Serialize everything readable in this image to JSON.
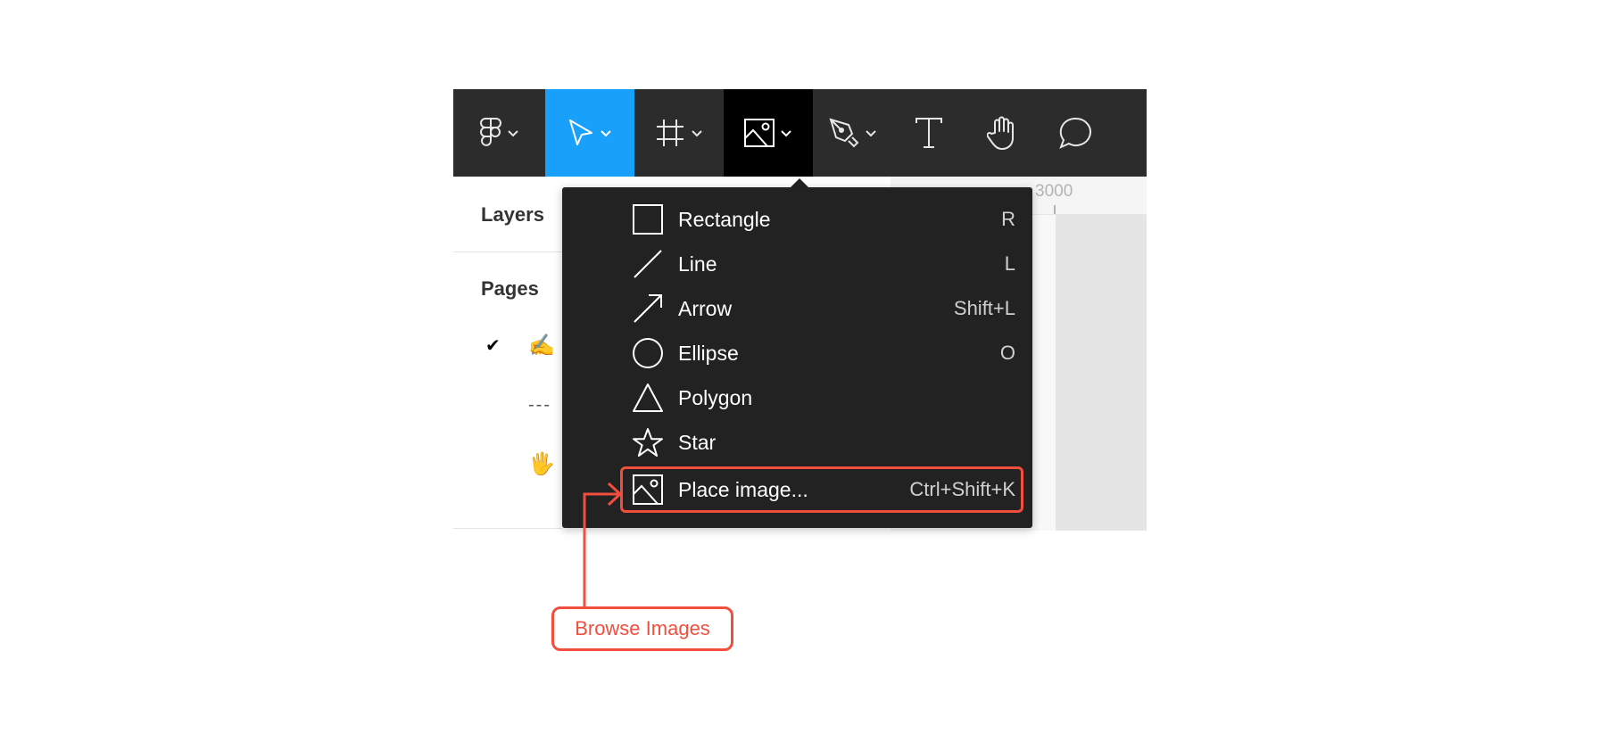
{
  "toolbar": {
    "tools": [
      {
        "name": "main-menu",
        "icon": "figma-logo-icon",
        "has_dropdown": true
      },
      {
        "name": "move-tool",
        "icon": "cursor-arrow-icon",
        "has_dropdown": true,
        "active": true
      },
      {
        "name": "frame-tool",
        "icon": "frame-hash-icon",
        "has_dropdown": true
      },
      {
        "name": "shape-tool",
        "icon": "image-icon",
        "has_dropdown": true,
        "open": true
      },
      {
        "name": "pen-tool",
        "icon": "pen-nib-icon",
        "has_dropdown": true
      },
      {
        "name": "text-tool",
        "icon": "text-t-icon",
        "has_dropdown": false
      },
      {
        "name": "hand-tool",
        "icon": "hand-icon",
        "has_dropdown": false
      },
      {
        "name": "comment-tool",
        "icon": "speech-bubble-icon",
        "has_dropdown": false
      }
    ],
    "colors": {
      "background": "#2c2c2c",
      "active": "#18a0fb",
      "open": "#000000"
    }
  },
  "left_panel": {
    "layers_title": "Layers",
    "pages_title": "Pages",
    "pages": [
      {
        "checked": true,
        "emoji": "✍️",
        "label": ""
      },
      {
        "checked": false,
        "emoji": "",
        "label": "---"
      },
      {
        "checked": false,
        "emoji": "🖐️",
        "label": ""
      }
    ]
  },
  "ruler": {
    "label": "3000"
  },
  "menu": {
    "items": [
      {
        "icon": "rectangle-icon",
        "label": "Rectangle",
        "shortcut": "R"
      },
      {
        "icon": "line-icon",
        "label": "Line",
        "shortcut": "L"
      },
      {
        "icon": "arrow-icon",
        "label": "Arrow",
        "shortcut": "Shift+L"
      },
      {
        "icon": "ellipse-icon",
        "label": "Ellipse",
        "shortcut": "O"
      },
      {
        "icon": "polygon-icon",
        "label": "Polygon",
        "shortcut": ""
      },
      {
        "icon": "star-icon",
        "label": "Star",
        "shortcut": ""
      },
      {
        "icon": "image-icon",
        "label": "Place image...",
        "shortcut": "Ctrl+Shift+K",
        "highlighted": true
      }
    ]
  },
  "annotation": {
    "label": "Browse Images",
    "color": "#f24e3e"
  }
}
